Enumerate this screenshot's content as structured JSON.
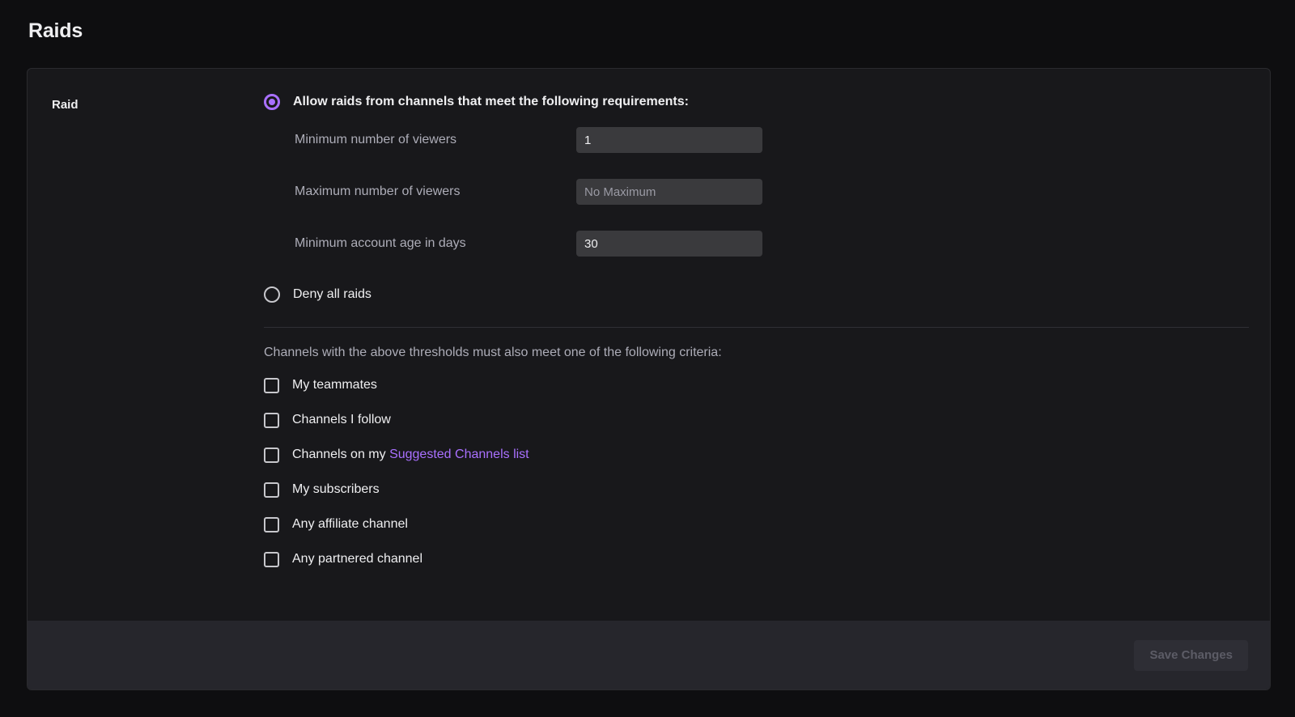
{
  "page": {
    "title": "Raids"
  },
  "section": {
    "label": "Raid"
  },
  "radio_options": [
    {
      "id": "allow-raids",
      "label": "Allow raids from channels that meet the following requirements:",
      "selected": true,
      "bold": true
    },
    {
      "id": "deny-all-raids",
      "label": "Deny all raids",
      "selected": false,
      "bold": false
    }
  ],
  "fields": [
    {
      "id": "minimum-viewers",
      "label": "Minimum number of viewers",
      "value": "1",
      "placeholder": ""
    },
    {
      "id": "maximum-viewers",
      "label": "Maximum number of viewers",
      "value": "",
      "placeholder": "No Maximum"
    },
    {
      "id": "minimum-account-age",
      "label": "Minimum account age in days",
      "value": "30",
      "placeholder": ""
    }
  ],
  "criteria": {
    "intro": "Channels with the above thresholds must also meet one of the following criteria:",
    "items": [
      {
        "id": "my-teammates",
        "label": "My teammates",
        "checked": false,
        "link_text": ""
      },
      {
        "id": "channels-i-follow",
        "label": "Channels I follow",
        "checked": false,
        "link_text": ""
      },
      {
        "id": "suggested-channels",
        "label": "Channels on my ",
        "checked": false,
        "link_text": "Suggested Channels list"
      },
      {
        "id": "my-subscribers",
        "label": "My subscribers",
        "checked": false,
        "link_text": ""
      },
      {
        "id": "any-affiliate",
        "label": "Any affiliate channel",
        "checked": false,
        "link_text": ""
      },
      {
        "id": "any-partnered",
        "label": "Any partnered channel",
        "checked": false,
        "link_text": ""
      }
    ]
  },
  "footer": {
    "save_label": "Save Changes",
    "save_disabled": true
  },
  "colors": {
    "page_background": "#0e0e10",
    "card_background": "#18181b",
    "footer_background": "#26262c",
    "accent_purple": "#a970ff",
    "input_background": "#3a3a3d",
    "text_primary": "#efeff1",
    "text_secondary": "#adadb8",
    "disabled_text": "#5c5c66"
  }
}
